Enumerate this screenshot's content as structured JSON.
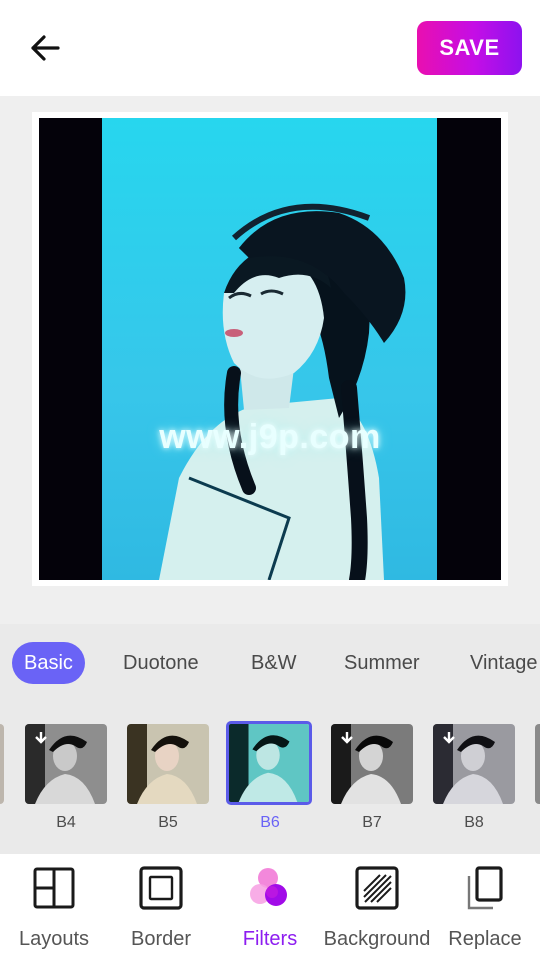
{
  "header": {
    "back_icon": "arrow-left-icon",
    "save_label": "SAVE",
    "save_gradient": [
      "#e90fb0",
      "#8d12ef"
    ]
  },
  "canvas": {
    "watermark": "www.j9p.com",
    "sky_color": "#22d4ee",
    "border_color": "#04020a"
  },
  "filter_categories": [
    {
      "label": "Basic",
      "active": true
    },
    {
      "label": "Duotone",
      "active": false
    },
    {
      "label": "B&W",
      "active": false
    },
    {
      "label": "Summer",
      "active": false
    },
    {
      "label": "Vintage",
      "active": false
    }
  ],
  "filters": [
    {
      "label": "B4",
      "tone": "mono",
      "selected": false
    },
    {
      "label": "B5",
      "tone": "warm",
      "selected": false
    },
    {
      "label": "B6",
      "tone": "cyan",
      "selected": true
    },
    {
      "label": "B7",
      "tone": "mono",
      "selected": false
    },
    {
      "label": "B8",
      "tone": "mono",
      "selected": false
    }
  ],
  "toolbar": {
    "items": [
      {
        "label": "Layouts",
        "icon": "layouts-icon",
        "active": false
      },
      {
        "label": "Border",
        "icon": "border-icon",
        "active": false
      },
      {
        "label": "Filters",
        "icon": "filters-icon",
        "active": true
      },
      {
        "label": "Background",
        "icon": "background-icon",
        "active": false
      },
      {
        "label": "Replace",
        "icon": "replace-icon",
        "active": false
      }
    ]
  },
  "colors": {
    "accent": "#6a63f6",
    "active_tool": "#8d1df0",
    "tab_text": "#4a4a4a"
  }
}
